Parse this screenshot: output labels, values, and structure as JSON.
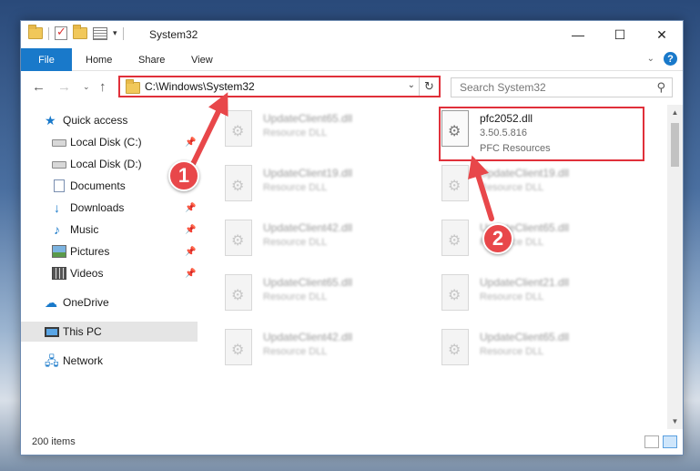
{
  "window": {
    "title": "System32",
    "controls": {
      "minimize": "—",
      "maximize": "☐",
      "close": "✕"
    }
  },
  "ribbon": {
    "file": "File",
    "tabs": [
      "Home",
      "Share",
      "View"
    ]
  },
  "address": {
    "path": "C:\\Windows\\System32",
    "search_placeholder": "Search System32"
  },
  "sidebar": {
    "items": [
      {
        "label": "Quick access",
        "icon": "star-icon",
        "pinned": false
      },
      {
        "label": "Local Disk (C:)",
        "icon": "disk-icon",
        "pinned": true
      },
      {
        "label": "Local Disk (D:)",
        "icon": "disk-icon",
        "pinned": false
      },
      {
        "label": "Documents",
        "icon": "documents-icon",
        "pinned": true
      },
      {
        "label": "Downloads",
        "icon": "downloads-icon",
        "pinned": true
      },
      {
        "label": "Music",
        "icon": "music-icon",
        "pinned": true
      },
      {
        "label": "Pictures",
        "icon": "pictures-icon",
        "pinned": true
      },
      {
        "label": "Videos",
        "icon": "videos-icon",
        "pinned": true
      },
      {
        "label": "OneDrive",
        "icon": "onedrive-icon",
        "pinned": false
      },
      {
        "label": "This PC",
        "icon": "this-pc-icon",
        "pinned": false,
        "selected": true
      },
      {
        "label": "Network",
        "icon": "network-icon",
        "pinned": false
      }
    ]
  },
  "files": {
    "highlighted": {
      "name": "pfc2052.dll",
      "version": "3.50.5.816",
      "type": "PFC Resources"
    },
    "blurred": [
      {
        "name": "UpdateClient65.dll",
        "type": "Resource DLL"
      },
      {
        "name": "UpdateClient19.dll",
        "type": "Resource DLL"
      },
      {
        "name": "UpdateClient19.dll",
        "type": "Resource DLL"
      },
      {
        "name": "UpdateClient42.dll",
        "type": "Resource DLL"
      },
      {
        "name": "UpdateClient65.dll",
        "type": "Resource DLL"
      },
      {
        "name": "UpdateClient65.dll",
        "type": "Resource DLL"
      },
      {
        "name": "UpdateClient21.dll",
        "type": "Resource DLL"
      },
      {
        "name": "UpdateClient42.dll",
        "type": "Resource DLL"
      },
      {
        "name": "UpdateClient65.dll",
        "type": "Resource DLL"
      }
    ]
  },
  "status": {
    "item_count": "200 items"
  },
  "callouts": {
    "one": "1",
    "two": "2"
  },
  "colors": {
    "accent": "#1979ca",
    "annotation": "#e0303a"
  }
}
